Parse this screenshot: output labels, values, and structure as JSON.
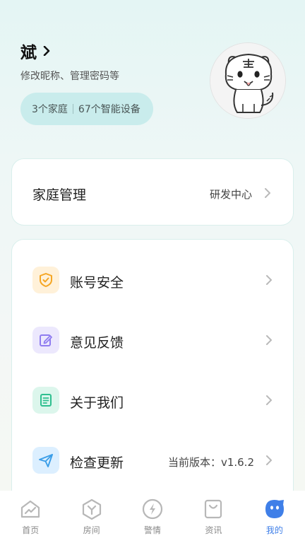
{
  "profile": {
    "name": "斌",
    "subtitle": "修改昵称、管理密码等",
    "families": "3个家庭",
    "devices": "67个智能设备"
  },
  "home_card": {
    "title": "家庭管理",
    "value": "研发中心"
  },
  "menu": {
    "items": [
      {
        "label": "账号安全",
        "icon": "shield-check-icon",
        "color": "#f5a623",
        "bg": "#fff1d9",
        "value": ""
      },
      {
        "label": "意见反馈",
        "icon": "edit-note-icon",
        "color": "#8f7cf0",
        "bg": "#ece8fd",
        "value": ""
      },
      {
        "label": "关于我们",
        "icon": "document-icon",
        "color": "#2fbf8f",
        "bg": "#dcf6ec",
        "value": ""
      },
      {
        "label": "检查更新",
        "icon": "paper-plane-icon",
        "color": "#3b9ee8",
        "bg": "#dcefff",
        "value": "当前版本：v1.6.2"
      }
    ]
  },
  "tabbar": {
    "active_color": "#3f7fe8",
    "inactive_color": "#b7b7b7",
    "tabs": [
      {
        "label": "首页",
        "icon": "home-icon",
        "active": false
      },
      {
        "label": "房间",
        "icon": "room-icon",
        "active": false
      },
      {
        "label": "警情",
        "icon": "alert-bolt-icon",
        "active": false
      },
      {
        "label": "资讯",
        "icon": "bag-icon",
        "active": false
      },
      {
        "label": "我的",
        "icon": "profile-face-icon",
        "active": true
      }
    ]
  }
}
